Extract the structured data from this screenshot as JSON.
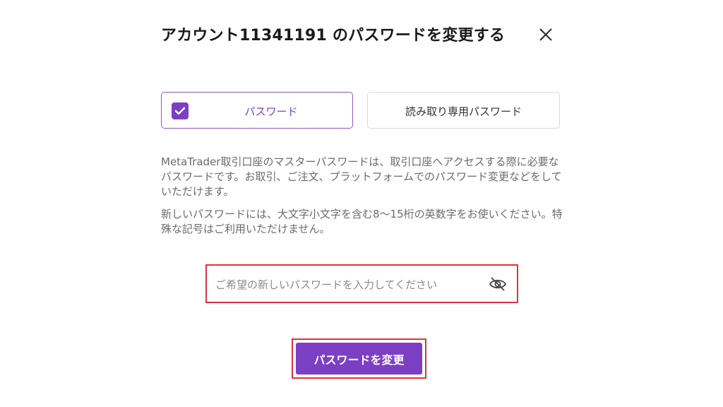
{
  "dialog": {
    "title": "アカウント11341191 のパスワードを変更する",
    "close_icon": "close-icon"
  },
  "password_type": {
    "options": [
      {
        "label": "パスワード",
        "selected": true,
        "icon": "checkbox-checked-icon"
      },
      {
        "label": "読み取り専用パスワード",
        "selected": false
      }
    ]
  },
  "description": {
    "paragraph1": "MetaTrader取引口座のマスターパスワードは、取引口座へアクセスする際に必要なパスワードです。お取引、ご注文、プラットフォームでのパスワード変更などをしていただけます。",
    "paragraph2": "新しいパスワードには、大文字小文字を含む8〜15桁の英数字をお使いください。特殊な記号はご利用いただけません。"
  },
  "new_password": {
    "value": "",
    "placeholder": "ご希望の新しいパスワードを入力してください",
    "toggle_icon": "eye-off-icon"
  },
  "submit": {
    "label": "パスワードを変更"
  },
  "colors": {
    "accent": "#7b3fc4",
    "highlight_border": "#e03434",
    "frame": "#3b3b3b"
  }
}
